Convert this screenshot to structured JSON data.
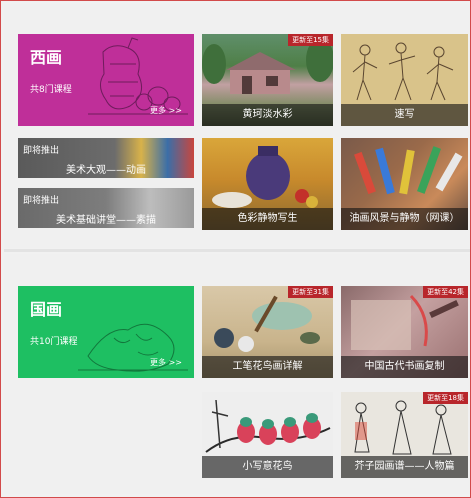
{
  "sections": [
    {
      "hero": {
        "title": "西画",
        "count": "共8门课程",
        "more": "更多 >>"
      },
      "upcoming": [
        {
          "tag": "即将推出",
          "name": "美术大观——动画"
        },
        {
          "tag": "即将推出",
          "name": "美术基础讲堂——素描"
        }
      ],
      "courses": [
        {
          "label": "黄珂淡水彩",
          "ribbon": "更新至15集"
        },
        {
          "label": "速写",
          "ribbon": ""
        },
        {
          "label": "色彩静物写生",
          "ribbon": ""
        },
        {
          "label": "油画风景与静物（网课）",
          "ribbon": ""
        }
      ]
    },
    {
      "hero": {
        "title": "国画",
        "count": "共10门课程",
        "more": "更多 >>"
      },
      "courses": [
        {
          "label": "工笔花鸟画详解",
          "ribbon": "更新至31集"
        },
        {
          "label": "中国古代书画复制",
          "ribbon": "更新至42集"
        },
        {
          "label": "小写意花鸟",
          "ribbon": ""
        },
        {
          "label": "芥子园画谱——人物篇",
          "ribbon": "更新至18集"
        }
      ]
    }
  ],
  "colors": {
    "western_accent": "#bf2f99",
    "chinese_accent": "#1ebf62",
    "ribbon": "#b8262b",
    "border": "#d24a4a"
  }
}
